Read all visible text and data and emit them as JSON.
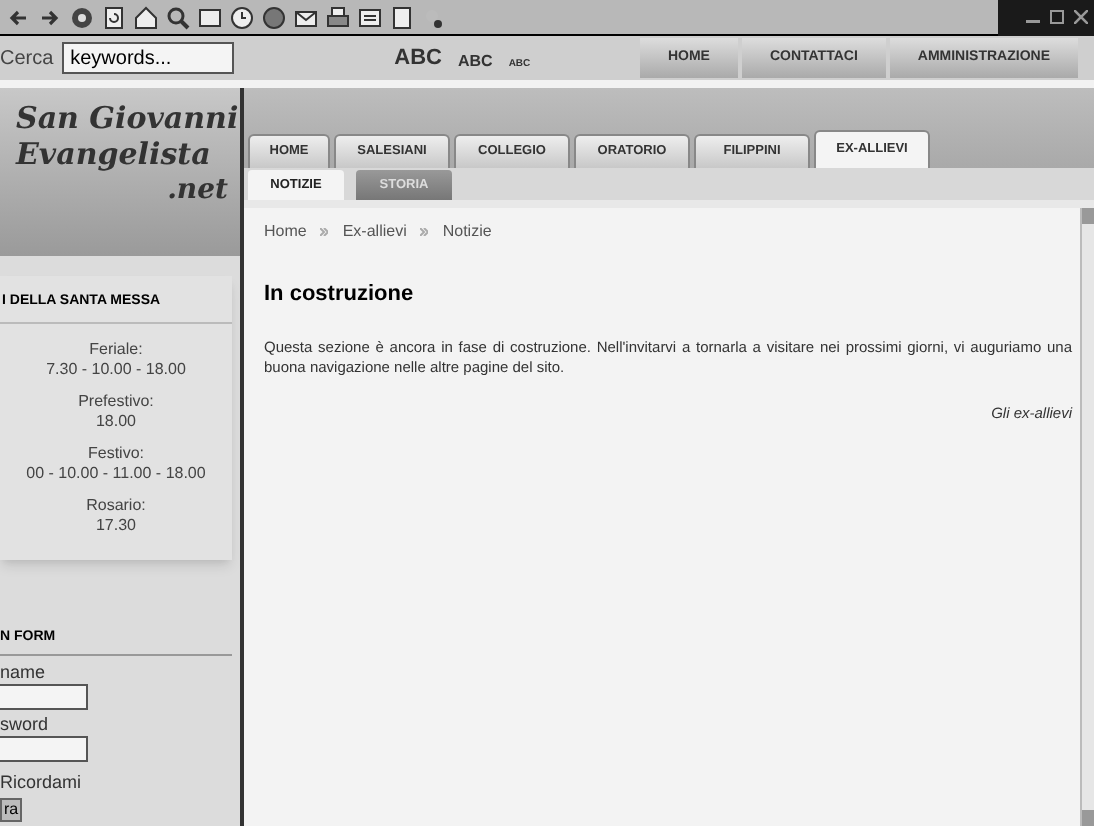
{
  "search": {
    "label": "Cerca",
    "value": "keywords..."
  },
  "font_sizes": [
    "ABC",
    "ABC",
    "ABC"
  ],
  "top_nav": [
    "HOME",
    "CONTATTACI",
    "AMMINISTRAZIONE"
  ],
  "logo": [
    "San Giovanni",
    "Evangelista",
    ".net"
  ],
  "tabs": [
    {
      "label": "HOME",
      "selected": false
    },
    {
      "label": "SALESIANI",
      "selected": false
    },
    {
      "label": "COLLEGIO",
      "selected": false
    },
    {
      "label": "ORATORIO",
      "selected": false
    },
    {
      "label": "FILIPPINI",
      "selected": false
    },
    {
      "label": "EX-ALLIEVI",
      "selected": true
    }
  ],
  "subtabs": [
    {
      "label": "NOTIZIE",
      "selected": true
    },
    {
      "label": "STORIA",
      "selected": false
    }
  ],
  "mass_box": {
    "title": "I DELLA SANTA MESSA",
    "entries": [
      {
        "label": "Feriale:",
        "time": "7.30 - 10.00 - 18.00"
      },
      {
        "label": "Prefestivo:",
        "time": "18.00"
      },
      {
        "label": "Festivo:",
        "time": "00 - 10.00 - 11.00 - 18.00"
      },
      {
        "label": "Rosario:",
        "time": "17.30"
      }
    ]
  },
  "login": {
    "title": "N FORM",
    "fields": [
      "name",
      "sword"
    ],
    "remember": "Ricordami",
    "button": "ra"
  },
  "breadcrumb": [
    "Home",
    "Ex-allievi",
    "Notizie"
  ],
  "heading": "In costruzione",
  "paragraph": "Questa sezione è ancora in fase di costruzione. Nell'invitarvi a tornarla a visitare nei prossimi giorni, vi auguriamo una buona navigazione nelle altre pagine del sito.",
  "signature": "Gli ex-allievi"
}
